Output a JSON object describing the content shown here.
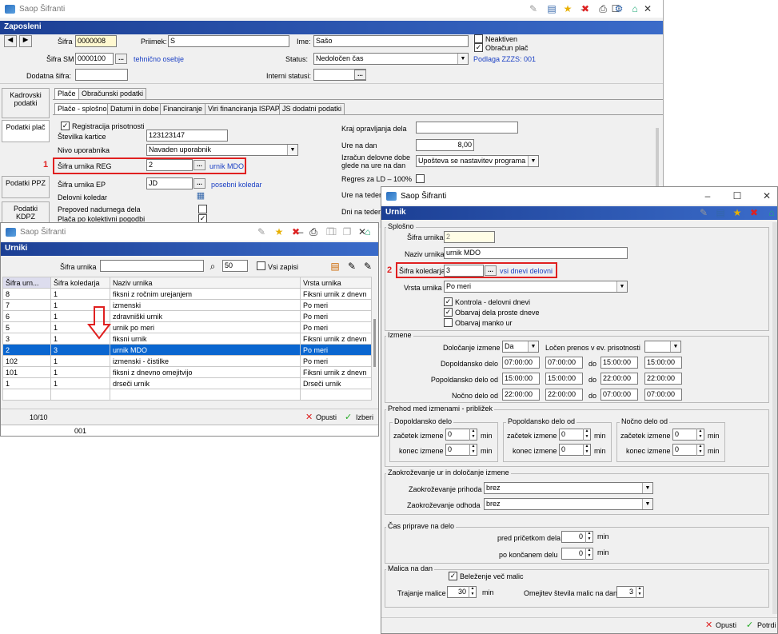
{
  "app_title": "Saop Šifranti",
  "main": {
    "banner": "Zaposleni",
    "sifra_label": "Šifra",
    "sifra_value": "0000008",
    "priimek_label": "Priimek:",
    "priimek_value": "S",
    "ime_label": "Ime:",
    "ime_value": "Sašo",
    "neaktiven_label": "Neaktiven",
    "obracun_label": "Obračun plač",
    "sifra_sm_label": "Šifra SM",
    "sifra_sm_value": "0000100",
    "sm_link": "tehnično osebje",
    "status_label": "Status:",
    "status_value": "Nedoločen čas",
    "podlaga": "Podlaga ZZZS: 001",
    "dodatna_label": "Dodatna šifra:",
    "interni_label": "Interni statusi:",
    "tabs_top": [
      "Plače",
      "Obračunski podatki"
    ],
    "tabs_sub": [
      "Plače - splošno",
      "Datumi in dobe",
      "Financiranje",
      "Viri financiranja ISPAP",
      "JS dodatni podatki"
    ],
    "side_buttons": [
      "Kadrovski podatki",
      "Podatki plač",
      "Podatki PPZ",
      "Podatki KDPZ"
    ],
    "registracija_label": "Registracija prisotnosti",
    "st_kartice_label": "Številka kartice",
    "st_kartice_value": "123123147",
    "nivo_label": "Nivo uporabnika",
    "nivo_value": "Navaden uporabnik",
    "sifra_urnika_reg_label": "Šifra urnika REG",
    "sifra_urnika_reg_value": "2",
    "urnik_link": "urnik MDO",
    "sifra_urnika_ep_label": "Šifra urnika EP",
    "sifra_urnika_ep_value": "JD",
    "ep_link": "posebni koledar",
    "delovni_koledar_label": "Delovni koledar",
    "prepoved_label": "Prepoved nadurnega dela",
    "placa_label": "Plača po kolektivni pogodbi",
    "kraj_label": "Kraj opravljanja dela",
    "ure_label": "Ure na dan",
    "ure_value": "8,00",
    "izracun_label": "Izračun delovne dobe glede na ure na dan",
    "izracun_value": "Upošteva se nastavitev programa",
    "regres_label": "Regres za LD – 100%",
    "ure_teden_label": "Ure na teden",
    "dni_teden_label": "Dni na teden",
    "marker_1": "1"
  },
  "urniki": {
    "title": "Saop Šifranti",
    "banner": "Urniki",
    "filter_label": "Šifra urnika",
    "count_value": "50",
    "vsi_label": "Vsi zapisi",
    "columns": [
      "Šifra urn...",
      "Šifra koledarja",
      "Naziv urnika",
      "Vrsta urnika"
    ],
    "rows": [
      [
        "8",
        "1",
        "fiksni z ročnim urejanjem",
        "Fiksni urnik z dnevn"
      ],
      [
        "7",
        "1",
        "izmenski",
        "Po meri"
      ],
      [
        "6",
        "1",
        "zdravniški urnik",
        "Po meri"
      ],
      [
        "5",
        "1",
        "urnik po meri",
        "Po meri"
      ],
      [
        "3",
        "1",
        "fiksni urnik",
        "Fiksni urnik z dnevn"
      ],
      [
        "2",
        "3",
        "urnik MDO",
        "Po meri"
      ],
      [
        "102",
        "1",
        "izmenski - čistilke",
        "Po meri"
      ],
      [
        "101",
        "1",
        "fiksni z dnevno omejitvijo",
        "Fiksni urnik z dnevn"
      ],
      [
        "1",
        "1",
        "drseči urnik",
        "Drseči urnik"
      ]
    ],
    "selected_row": 5,
    "record_count": "10/10",
    "opusti": "Opusti",
    "izberi": "Izberi",
    "status_code": "001"
  },
  "urnik": {
    "title": "Saop Šifranti",
    "banner": "Urnik",
    "splosno_group": "Splošno",
    "sifra_urnika_label": "Šifra urnika",
    "sifra_urnika_value": "2",
    "naziv_label": "Naziv urnika",
    "naziv_value": "urnik MDO",
    "sifra_koledarja_label": "Šifra koledarja",
    "sifra_koledarja_value": "3",
    "koledar_link": "vsi dnevi delovni",
    "marker_2": "2",
    "vrsta_label": "Vrsta urnika",
    "vrsta_value": "Po meri",
    "kontrola_label": "Kontrola - delovni dnevi",
    "obarvaj_label": "Obarvaj dela proste dneve",
    "manko_label": "Obarvaj manko ur",
    "izmene_group": "Izmene",
    "dolocanje_label": "Določanje izmene",
    "dolocanje_value": "Da",
    "locen_label": "Ločen prenos v ev. prisotnosti",
    "shift_rows": [
      {
        "label": "Dopoldansko delo",
        "a": "07:00:00",
        "b": "07:00:00",
        "c": "15:00:00",
        "d": "15:00:00"
      },
      {
        "label": "Popoldansko delo od",
        "a": "15:00:00",
        "b": "15:00:00",
        "c": "22:00:00",
        "d": "22:00:00"
      },
      {
        "label": "Nočno delo od",
        "a": "22:00:00",
        "b": "22:00:00",
        "c": "07:00:00",
        "d": "07:00:00"
      }
    ],
    "do_label": "do",
    "prehod_group": "Prehod med izmenami - približek",
    "sub_groups": [
      "Dopoldansko delo",
      "Popoldansko delo od",
      "Nočno delo od"
    ],
    "zacetek_label": "začetek izmene",
    "konec_label": "konec izmene",
    "min_label": "min",
    "zero": "0",
    "zaokr_group": "Zaokroževanje ur in določanje izmene",
    "prihod_label": "Zaokroževanje prihoda",
    "prihod_value": "brez",
    "odhod_label": "Zaokroževanje odhoda",
    "odhod_value": "brez",
    "cas_group": "Čas priprave na delo",
    "pred_label": "pred pričetkom dela",
    "po_label": "po končanem delu",
    "malica_group": "Malica na dan",
    "belezenje_label": "Beleženje več malic",
    "trajanje_label": "Trajanje malice",
    "trajanje_value": "30",
    "omejitev_label": "Omejitev števila malic na dan",
    "omejitev_value": "3",
    "opusti": "Opusti",
    "potrdi": "Potrdi"
  }
}
